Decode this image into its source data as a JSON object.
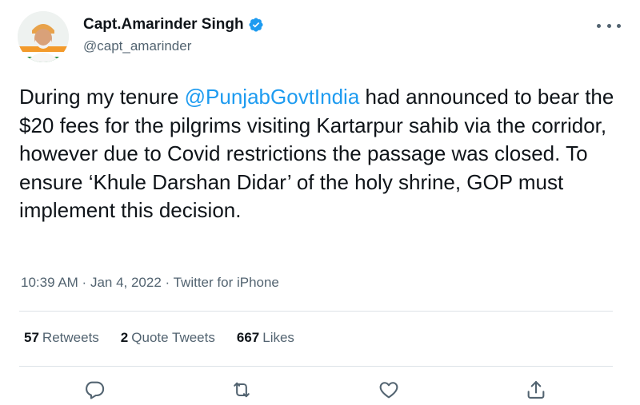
{
  "author": {
    "name": "Capt.Amarinder Singh",
    "handle": "@capt_amarinder"
  },
  "tweet": {
    "text_before": "During my tenure ",
    "mention": "@PunjabGovtIndia",
    "text_after": " had announced to bear the $20 fees for the pilgrims visiting Kartarpur sahib via the corridor, however due to Covid restrictions the passage was closed. To ensure ‘Khule Darshan Didar’ of the holy shrine, GOP must implement this decision."
  },
  "meta": {
    "time": "10:39 AM",
    "separator": " · ",
    "date": "Jan 4, 2022",
    "source": "Twitter for iPhone"
  },
  "stats": {
    "retweets_count": "57",
    "retweets_label": "Retweets",
    "quotes_count": "2",
    "quotes_label": "Quote Tweets",
    "likes_count": "667",
    "likes_label": "Likes"
  },
  "colors": {
    "accent": "#1d9bf0",
    "text": "#0f1419",
    "muted": "#536471"
  },
  "icons": {
    "more": "more-horizontal-icon",
    "verified": "verified-badge-icon",
    "reply": "reply-icon",
    "retweet": "retweet-icon",
    "like": "like-icon",
    "share": "share-icon"
  }
}
